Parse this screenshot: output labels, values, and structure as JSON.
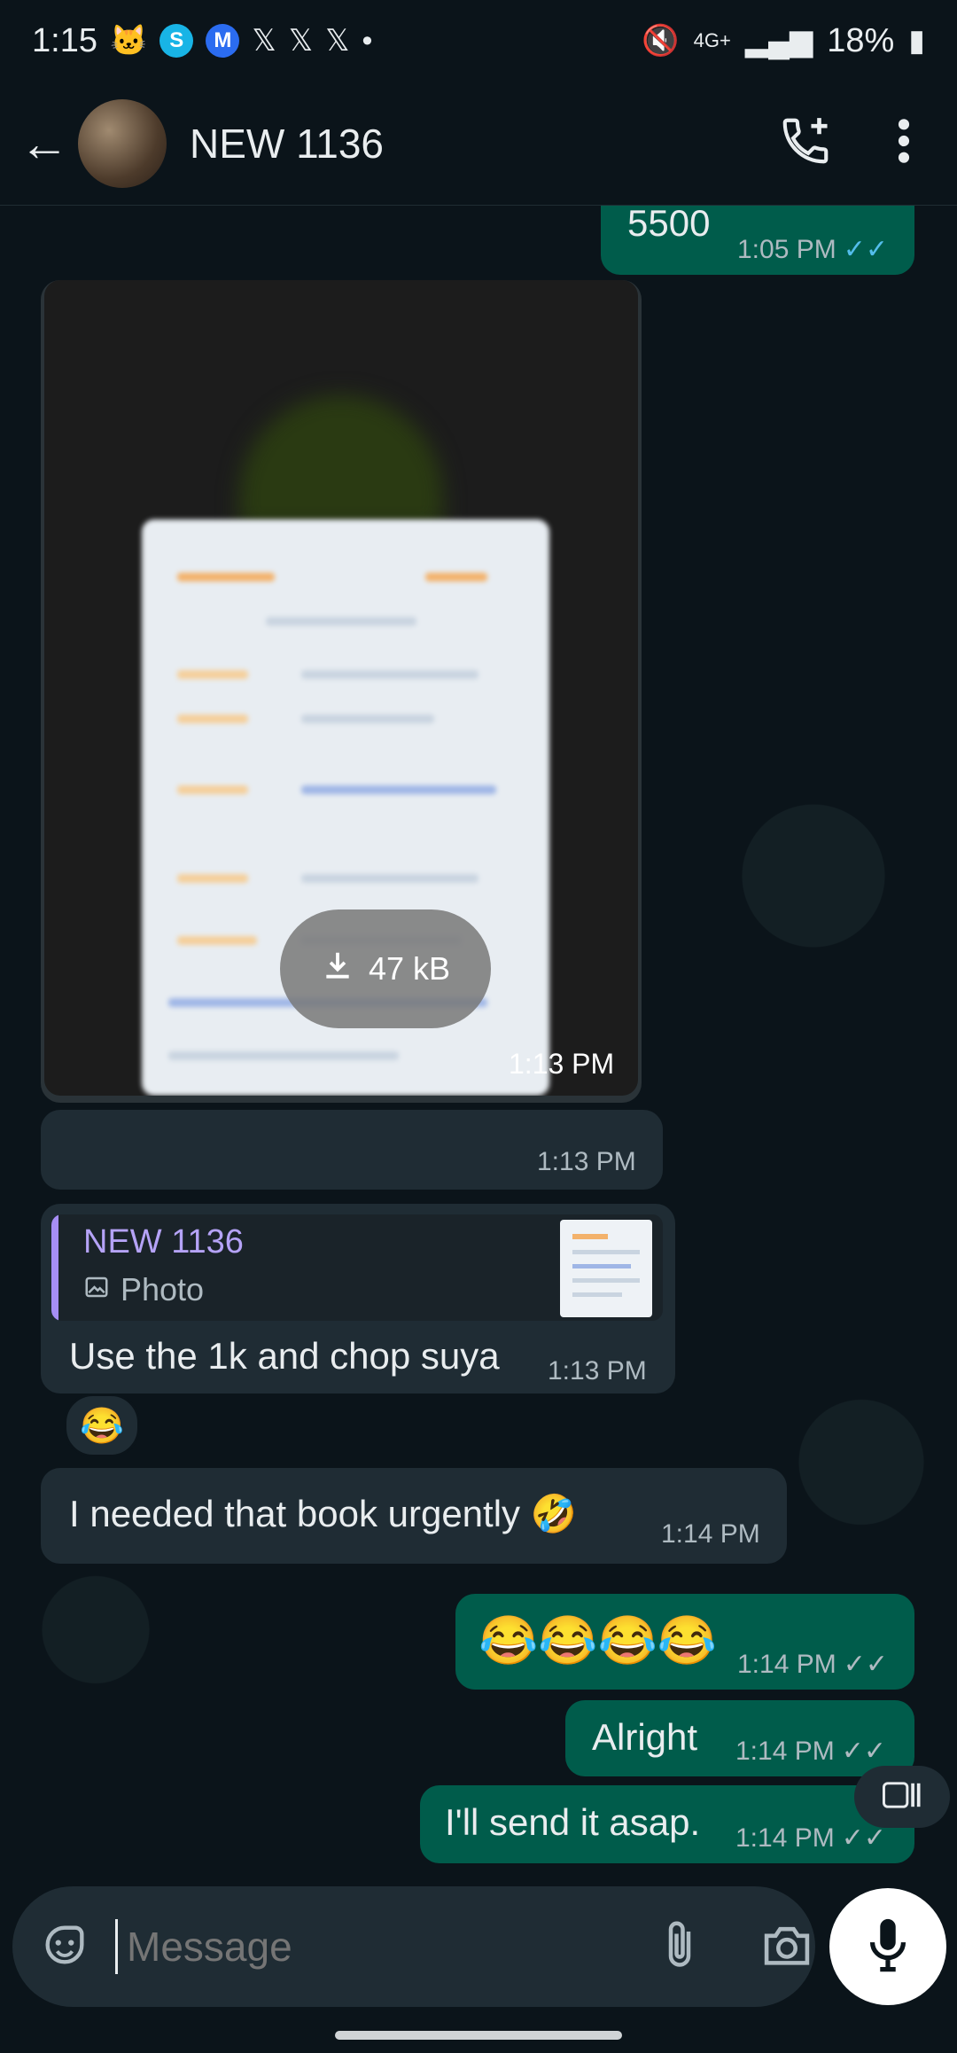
{
  "status_bar": {
    "time": "1:15",
    "network": "4G+",
    "battery": "18%"
  },
  "app_bar": {
    "back_label": "←",
    "contact_name": "NEW 1136"
  },
  "messages": {
    "prev_out": {
      "text": "5500",
      "time": "1:05 PM"
    },
    "image": {
      "download_size": "47 kB",
      "time": "1:13 PM"
    },
    "blank": {
      "text": "",
      "time": "1:13 PM"
    },
    "reply": {
      "quoted_name": "NEW 1136",
      "quoted_type": "Photo",
      "text": "Use the 1k and chop suya",
      "time": "1:13 PM",
      "reaction": "😂"
    },
    "book": {
      "text": "I needed that book urgently 🤣",
      "time": "1:14 PM"
    },
    "emoji_out": {
      "text": "😂😂😂😂",
      "time": "1:14 PM"
    },
    "alright": {
      "text": "Alright",
      "time": "1:14 PM"
    },
    "send": {
      "text": "I'll send it asap.",
      "time": "1:14 PM"
    }
  },
  "composer": {
    "placeholder": "Message"
  },
  "colors": {
    "background": "#0b141a",
    "incoming": "#1f2c34",
    "outgoing": "#005c4b",
    "read_ticks": "#53bdeb"
  },
  "icons": [
    "back-arrow-icon",
    "add-call-icon",
    "more-vert-icon",
    "download-icon",
    "photo-icon",
    "sticker-icon",
    "attach-icon",
    "camera-icon",
    "mic-icon",
    "mute-icon",
    "signal-icon",
    "battery-icon"
  ]
}
